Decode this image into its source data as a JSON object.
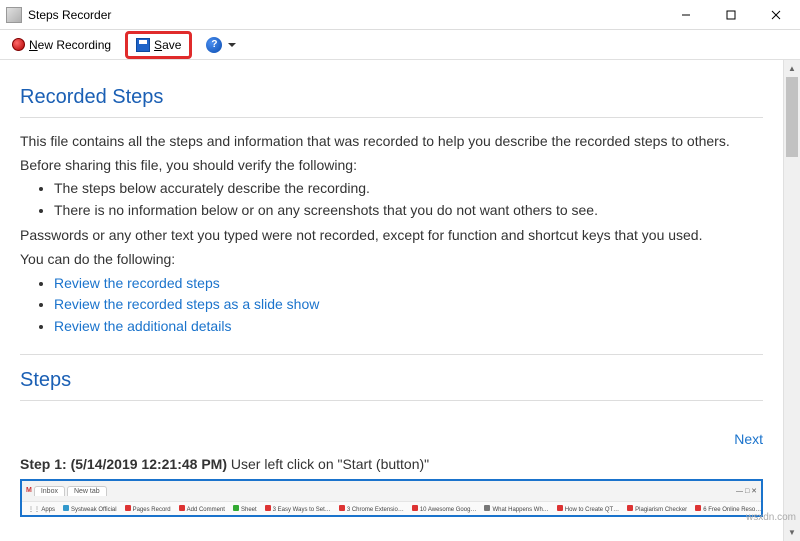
{
  "window": {
    "title": "Steps Recorder"
  },
  "toolbar": {
    "newRecording": "ew Recording",
    "newRecordingAccess": "N",
    "save": "ave",
    "saveAccess": "S"
  },
  "sections": {
    "recordedSteps": "Recorded Steps",
    "steps": "Steps"
  },
  "intro": {
    "p1": "This file contains all the steps and information that was recorded to help you describe the recorded steps to others.",
    "p2": "Before sharing this file, you should verify the following:",
    "bullet1": "The steps below accurately describe the recording.",
    "bullet2": "There is no information below or on any screenshots that you do not want others to see.",
    "p3": "Passwords or any other text you typed were not recorded, except for function and shortcut keys that you used.",
    "p4": "You can do the following:",
    "link1": "Review the recorded steps",
    "link2": "Review the recorded steps as a slide show",
    "link3": "Review the additional details"
  },
  "nav": {
    "next": "Next"
  },
  "step1": {
    "label": "Step 1:",
    "timestamp": "(5/14/2019 12:21:48 PM)",
    "action": "User left click on \"Start (button)\""
  },
  "watermark": "wsxdn.com"
}
